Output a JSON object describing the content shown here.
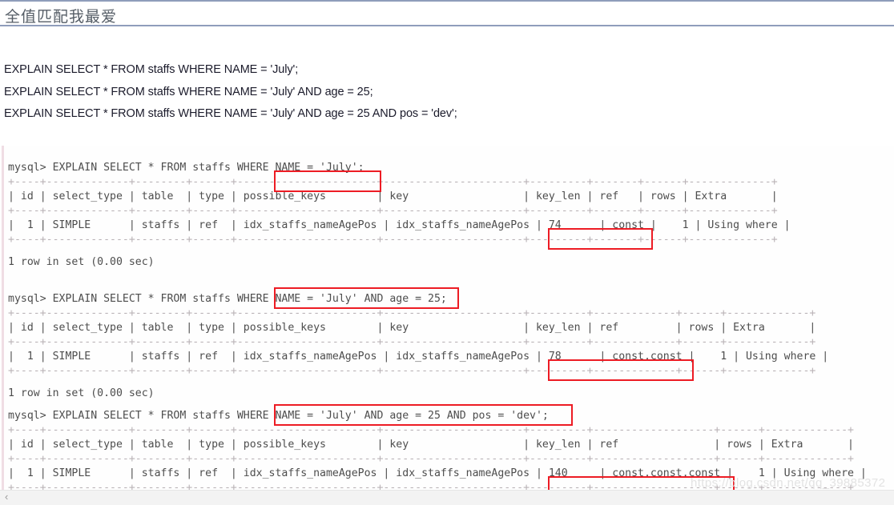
{
  "header": {
    "title": "全值匹配我最爱"
  },
  "sql_block": {
    "lines": [
      "EXPLAIN SELECT * FROM staffs WHERE NAME = 'July';",
      "EXPLAIN SELECT * FROM staffs WHERE NAME = 'July' AND age = 25;",
      "EXPLAIN SELECT * FROM staffs WHERE NAME = 'July' AND age = 25 AND pos = 'dev';"
    ]
  },
  "terminal": {
    "blocks": [
      {
        "prompt": "mysql> EXPLAIN SELECT * FROM staffs WHERE NAME = 'July';",
        "highlight": "NAME = 'July';",
        "rule_top": "+----+-------------+--------+------+----------------------+----------------------+---------+-------+------+-------------+",
        "header_row": "| id | select_type | table  | type | possible_keys        | key                  | key_len | ref   | rows | Extra       |",
        "rule_mid": "+----+-------------+--------+------+----------------------+----------------------+---------+-------+------+-------------+",
        "data_row": "|  1 | SIMPLE      | staffs | ref  | idx_staffs_nameAgePos | idx_staffs_nameAgePos | 74      | const |    1 | Using where |",
        "rule_bottom": "+----+-------------+--------+------+----------------------+----------------------+---------+-------+------+-------------+",
        "footer": "1 row in set (0.00 sec)",
        "columns": [
          "id",
          "select_type",
          "table",
          "type",
          "possible_keys",
          "key",
          "key_len",
          "ref",
          "rows",
          "Extra"
        ],
        "values": [
          "1",
          "SIMPLE",
          "staffs",
          "ref",
          "idx_staffs_nameAgePos",
          "idx_staffs_nameAgePos",
          "74",
          "const",
          "1",
          "Using where"
        ]
      },
      {
        "prompt": "mysql> EXPLAIN SELECT * FROM staffs WHERE NAME = 'July' AND age = 25;",
        "highlight": "NAME = 'July' AND age = 25;",
        "rule_top": "+----+-------------+--------+------+----------------------+----------------------+---------+-------------+------+-------------+",
        "header_row": "| id | select_type | table  | type | possible_keys        | key                  | key_len | ref         | rows | Extra       |",
        "rule_mid": "+----+-------------+--------+------+----------------------+----------------------+---------+-------------+------+-------------+",
        "data_row": "|  1 | SIMPLE      | staffs | ref  | idx_staffs_nameAgePos | idx_staffs_nameAgePos | 78      | const,const |    1 | Using where |",
        "rule_bottom": "+----+-------------+--------+------+----------------------+----------------------+---------+-------------+------+-------------+",
        "footer": "1 row in set (0.00 sec)",
        "columns": [
          "id",
          "select_type",
          "table",
          "type",
          "possible_keys",
          "key",
          "key_len",
          "ref",
          "rows",
          "Extra"
        ],
        "values": [
          "1",
          "SIMPLE",
          "staffs",
          "ref",
          "idx_staffs_nameAgePos",
          "idx_staffs_nameAgePos",
          "78",
          "const,const",
          "1",
          "Using where"
        ]
      },
      {
        "prompt": "mysql> EXPLAIN SELECT * FROM staffs WHERE NAME = 'July' AND age = 25 AND pos = 'dev';",
        "highlight": "NAME = 'July' AND age = 25 AND pos = 'dev';",
        "rule_top": "+----+-------------+--------+------+----------------------+----------------------+---------+-------------------+------+-------------+",
        "header_row": "| id | select_type | table  | type | possible_keys        | key                  | key_len | ref               | rows | Extra       |",
        "rule_mid": "+----+-------------+--------+------+----------------------+----------------------+---------+-------------------+------+-------------+",
        "data_row": "|  1 | SIMPLE      | staffs | ref  | idx_staffs_nameAgePos | idx_staffs_nameAgePos | 140     | const,const,const |    1 | Using where |",
        "rule_bottom": "+----+-------------+--------+------+----------------------+----------------------+---------+-------------------+------+-------------+",
        "footer": "",
        "columns": [
          "id",
          "select_type",
          "table",
          "type",
          "possible_keys",
          "key",
          "key_len",
          "ref",
          "rows",
          "Extra"
        ],
        "values": [
          "1",
          "SIMPLE",
          "staffs",
          "ref",
          "idx_staffs_nameAgePos",
          "idx_staffs_nameAgePos",
          "140",
          "const,const,const",
          "1",
          "Using where"
        ]
      }
    ]
  },
  "watermark": {
    "text": "https://blog.csdn.net/qq_39885372"
  },
  "bottom_bar": {
    "scroll_left_glyph": "‹"
  },
  "colors": {
    "annotation_red": "#ed1c24",
    "header_border": "#8f9dbb",
    "terminal_text": "#4a4a4a"
  }
}
